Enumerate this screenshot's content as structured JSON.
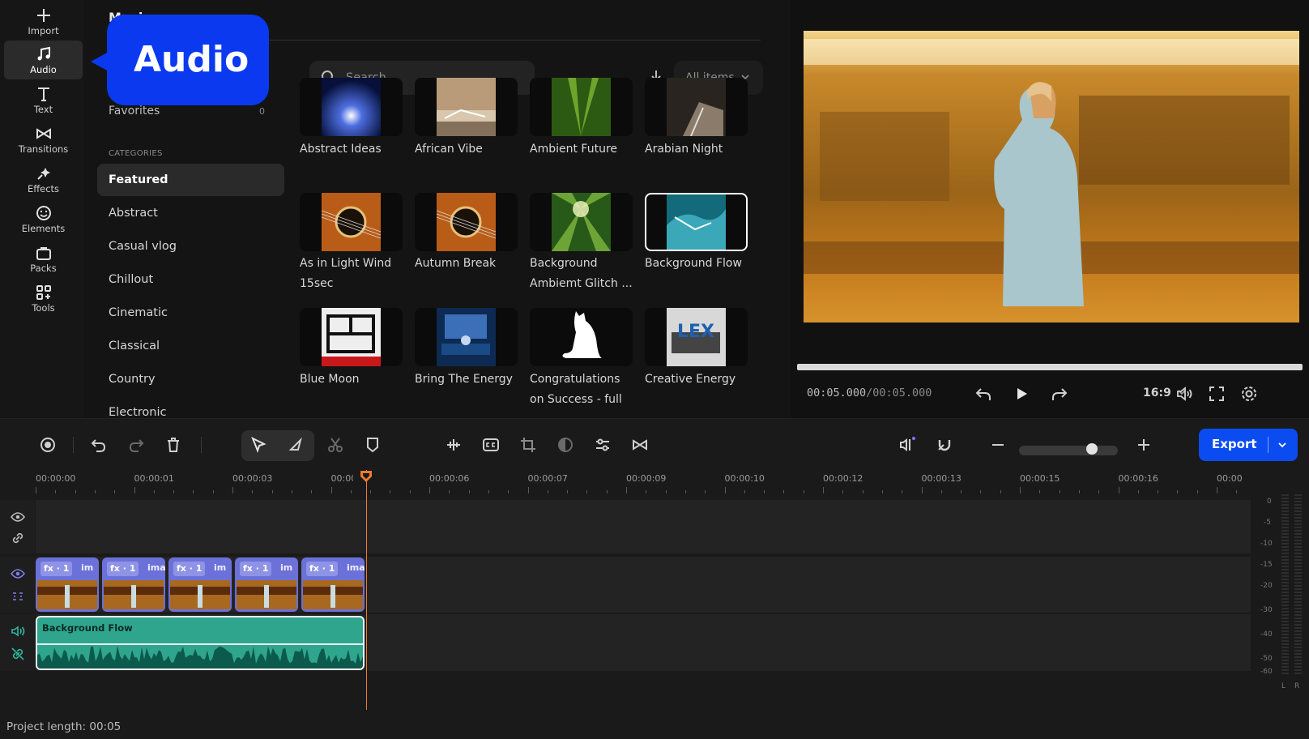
{
  "rail": {
    "items": [
      {
        "label": "Import",
        "icon": "plus-icon"
      },
      {
        "label": "Audio",
        "icon": "music-note-icon"
      },
      {
        "label": "Text",
        "icon": "text-icon"
      },
      {
        "label": "Transitions",
        "icon": "bowtie-icon"
      },
      {
        "label": "Effects",
        "icon": "sparkle-icon"
      },
      {
        "label": "Elements",
        "icon": "smiley-icon"
      },
      {
        "label": "Packs",
        "icon": "bag-icon"
      },
      {
        "label": "Tools",
        "icon": "grid-plus-icon"
      }
    ],
    "active": "Audio"
  },
  "callout": {
    "text": "Audio"
  },
  "library": {
    "title": "Music",
    "favorites_label": "Favorites",
    "favorites_count": "0",
    "categories_heading": "CATEGORIES",
    "categories": [
      "Featured",
      "Abstract",
      "Casual vlog",
      "Chillout",
      "Cinematic",
      "Classical",
      "Country",
      "Electronic"
    ],
    "search_placeholder": "Search",
    "filter_label": "All items",
    "tiles": [
      {
        "label": "Abstract Ideas"
      },
      {
        "label": "African Vibe"
      },
      {
        "label": "Ambient Future"
      },
      {
        "label": "Arabian Night"
      },
      {
        "label": "As in Light Wind 15sec"
      },
      {
        "label": "Autumn Break"
      },
      {
        "label": "Background Ambiemt Glitch ..."
      },
      {
        "label": "Background Flow"
      },
      {
        "label": "Blue Moon"
      },
      {
        "label": "Bring The Energy"
      },
      {
        "label": "Congratulations on Success - full ..."
      },
      {
        "label": "Creative Energy"
      }
    ]
  },
  "preview": {
    "timecode_current": "00:05.000",
    "timecode_total": "/00:05.000",
    "aspect_ratio": "16:9"
  },
  "toolbar": {
    "export_label": "Export"
  },
  "timeline": {
    "ruler_labels": [
      "00:00:00",
      "00:00:01",
      "00:00:03",
      "00:00:04",
      "00:00:06",
      "00:00:07",
      "00:00:09",
      "00:00:10",
      "00:00:12",
      "00:00:13",
      "00:00:15",
      "00:00:16",
      "00:00"
    ],
    "ruler_label_shown_at_playhead": "00:00",
    "video_clips": [
      {
        "badge": "fx · 1",
        "name": "im"
      },
      {
        "badge": "fx · 1",
        "name": "ima"
      },
      {
        "badge": "fx · 1",
        "name": "im"
      },
      {
        "badge": "fx · 1",
        "name": "im"
      },
      {
        "badge": "fx · 1",
        "name": "ima"
      }
    ],
    "audio_clip_name": "Background Flow",
    "meter_labels": [
      "0",
      "-5",
      "-10",
      "-15",
      "-20",
      "-30",
      "-40",
      "-50",
      "-60"
    ],
    "meter_channels": [
      "L",
      "R"
    ],
    "project_length": "Project length: 00:05"
  },
  "colors": {
    "accent": "#0a4cf0",
    "audio_clip": "#2fa58e",
    "video_clip": "#6b71d8",
    "playhead": "#f07b2c"
  }
}
